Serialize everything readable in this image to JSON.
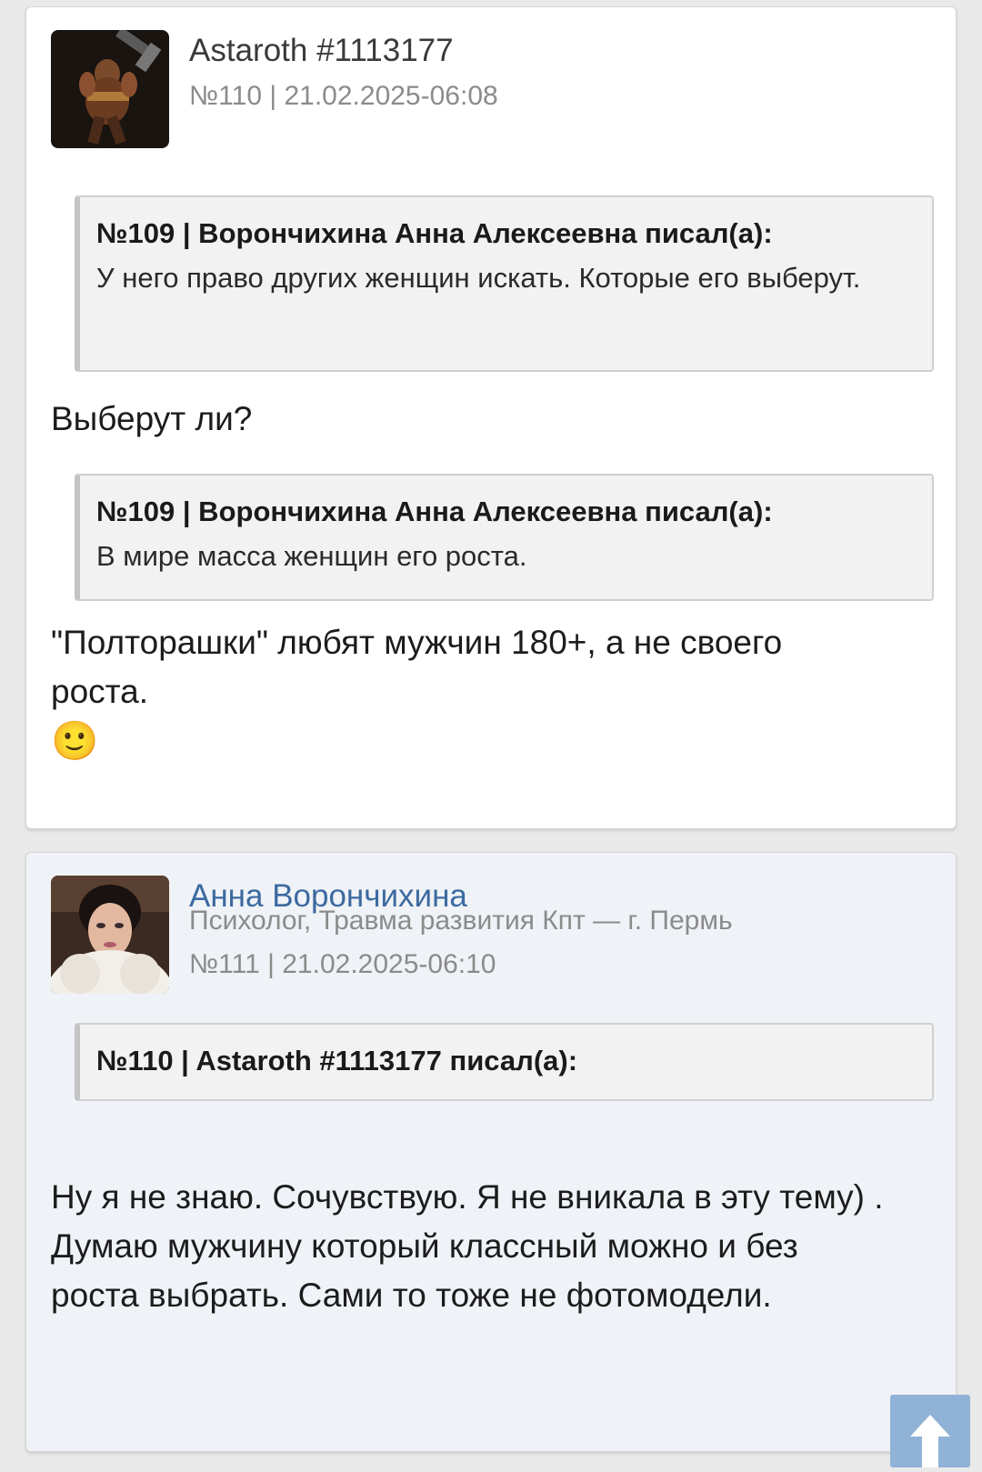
{
  "posts": [
    {
      "author": "Astaroth #1113177",
      "meta": "№110 | 21.02.2025-06:08",
      "quotes": [
        {
          "head": "№109 | Ворончихина Анна Алексеевна писал(а):",
          "body": "У него право других женщин искать. Которые его выберут."
        },
        {
          "head": "№109 | Ворончихина Анна Алексеевна писал(а):",
          "body": "В мире масса женщин его роста."
        }
      ],
      "texts": [
        "Выберут ли?",
        "\"Полторашки\" любят мужчин 180+, а не своего роста."
      ],
      "emoji": "🙂"
    },
    {
      "author": "Анна Ворончихина",
      "profession": "Психолог, Травма развития Кпт — г. Пермь",
      "meta": "№111 | 21.02.2025-06:10",
      "quotes": [
        {
          "head": "№110 | Astaroth #1113177 писал(а):",
          "body": ""
        }
      ],
      "texts": [
        "Ну я не знаю. Сочувствую. Я не вникала в эту тему) . Думаю мужчину который классный можно и без роста выбрать. Сами то тоже не фотомодели."
      ]
    }
  ],
  "icons": {
    "scroll_top": "arrow-up-icon"
  },
  "colors": {
    "author_link": "#3c6aa0",
    "post_alt_bg": "#eff2f6",
    "scroll_button": "#8fb2d6"
  }
}
